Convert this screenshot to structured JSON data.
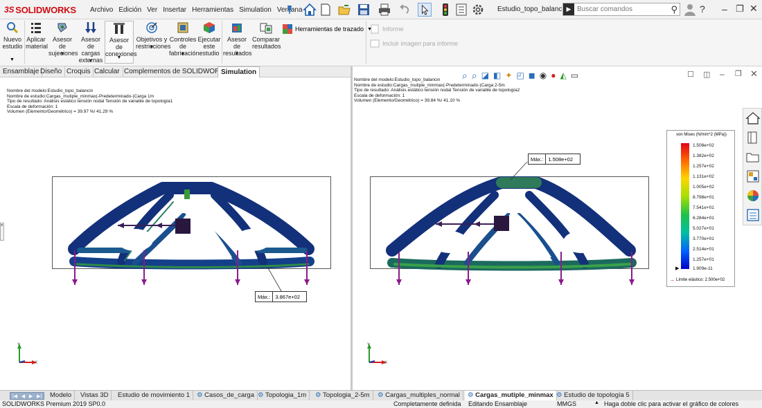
{
  "app": {
    "logo_prefix": "3S",
    "logo_name": "SOLIDWORKS",
    "document_title": "Estudio_topo_balancín *"
  },
  "menu": [
    "Archivo",
    "Edición",
    "Ver",
    "Insertar",
    "Herramientas",
    "Simulation",
    "Ventana",
    "?"
  ],
  "search": {
    "placeholder": "Buscar comandos"
  },
  "ribbon": {
    "nuevo_estudio": "Nuevo\nestudio",
    "aplicar_material": "Aplicar\nmaterial",
    "asesor_sujeciones": "Asesor de\nsujeciones",
    "asesor_cargas": "Asesor de\ncargas\nexternas",
    "asesor_conexiones": "Asesor de\nconexiones",
    "objetivos": "Objetivos y\nrestricciones",
    "controles": "Controles\nde\nfabricación",
    "ejecutar": "Ejecutar\neste\nestudio",
    "asesor_resultados": "Asesor de\nresultados",
    "comparar": "Comparar\nresultados",
    "herramientas_trazado": "Herramientas de trazado",
    "informe": "Informe",
    "incluir_imagen": "Incluir imagen para informe"
  },
  "command_tabs": [
    "Ensamblaje",
    "Diseño",
    "Croquis",
    "Calcular",
    "Complementos de SOLIDWORKS",
    "Simulation"
  ],
  "left_view": {
    "info": [
      "Nombre del modelo:Estudio_topo_balancin",
      "Nombre de estudio:Cargas_mutiple_minmax(-Predeterminado-)Carga 1m",
      "Tipo de resultado: Análisis estático tensión nodal Tensión de variable de topología1",
      "Escala de deformación: 1",
      "Volumen (Elemento/Geométrico) = 39.97 %/ 41.29 %"
    ],
    "max_label": "Máx.:",
    "max_value": "3.867e+02"
  },
  "right_view": {
    "info": [
      "Nombre del modelo:Estudio_topo_balancin",
      "Nombre de estudio:Cargas_mutiple_minmax(-Predeterminado-)Carga 2-5m",
      "Tipo de resultado: Análisis estático tensión nodal Tensión de variable de topología2",
      "Escala de deformación: 1",
      "Volumen (Elemento/Geométrico) = 39.84 %/ 41.10 %"
    ],
    "max_label": "Máx.:",
    "max_value": "1.508e+02"
  },
  "legend": {
    "title": "von Mises (N/mm^2 (MPa))",
    "ticks": [
      "1.508e+02",
      "1.382e+02",
      "1.257e+02",
      "1.131e+02",
      "1.005e+02",
      "8.798e+01",
      "7.541e+01",
      "6.284e+01",
      "5.027e+01",
      "3.770e+01",
      "2.514e+01",
      "1.257e+01",
      "1.909e-11"
    ],
    "yield": "Límite elástico: 2.500e+02"
  },
  "bottom_tabs": [
    "Modelo",
    "Vistas 3D",
    "Estudio de movimiento 1",
    "Casos_de_carga",
    "Topologia_1m",
    "Topologia_2-5m",
    "Cargas_multiples_normal",
    "Cargas_mutiple_minmax",
    "Estudio de topología 5"
  ],
  "status": {
    "version": "SOLIDWORKS Premium 2019 SP0.0",
    "definition": "Completamente definida",
    "mode": "Editando Ensamblaje",
    "units": "MMGS",
    "hint": "Haga doble clic para activar el gráfico de colores"
  },
  "axis": {
    "x": "X",
    "y": "Y",
    "z": "Z"
  }
}
